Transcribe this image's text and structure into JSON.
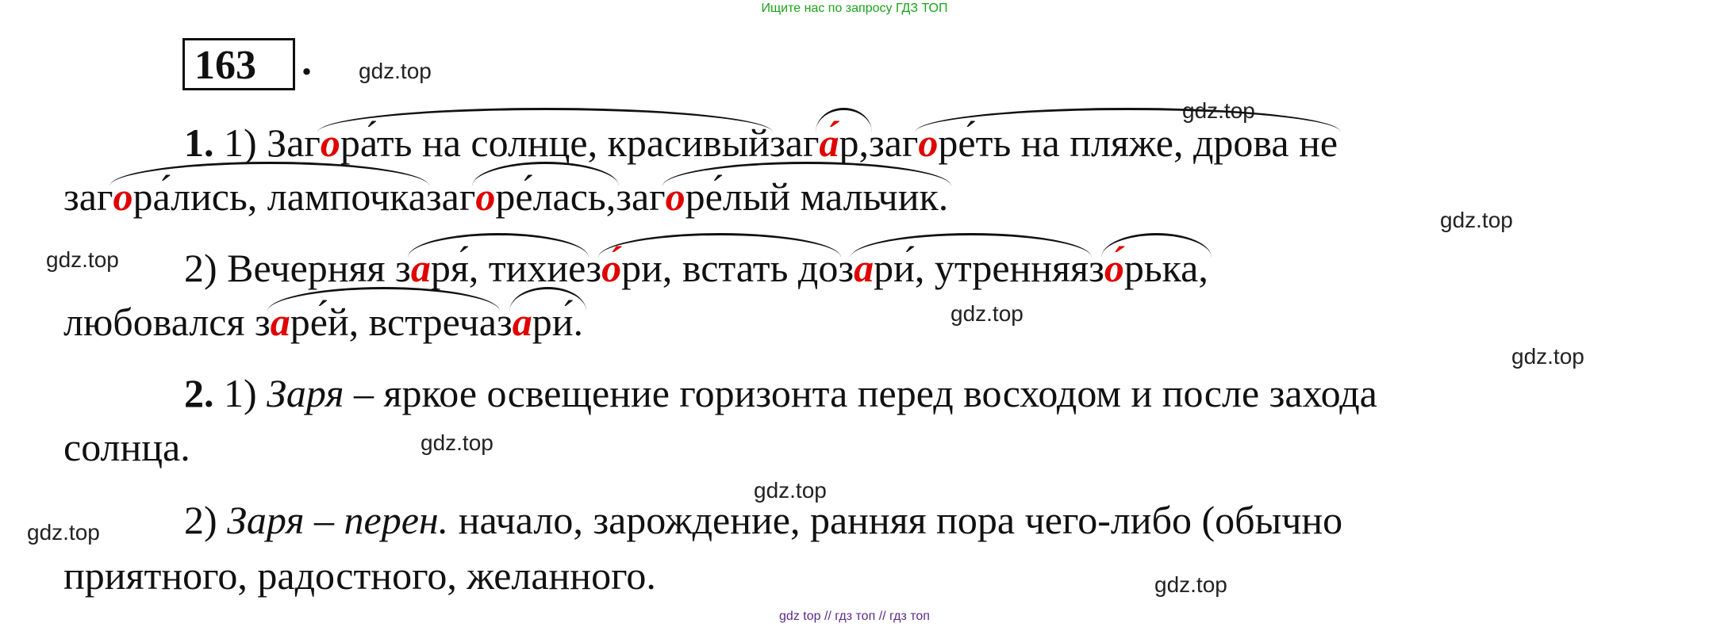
{
  "banner": "Ищите нас по запросу ГДЗ ТОП",
  "task_number": "163",
  "task_number_dot": ".",
  "watermark": "gdz.top",
  "lines": {
    "l1": {
      "num": "1.",
      "sub": " 1) ",
      "w1a": "Заг",
      "w1r": "о",
      "w1b": "ра́ть на солнце, красивый ",
      "w2a": "заг",
      "w2r": "а́",
      "w2b": "р, ",
      "w3a": "заг",
      "w3r": "о",
      "w3b": "ре́ть на пляже, дрова не"
    },
    "l2": {
      "w1a": "заг",
      "w1r": "о",
      "w1b": "ра́лись, лампочка ",
      "w2a": "заг",
      "w2r": "о",
      "w2b": "ре́лась, ",
      "w3a": "заг",
      "w3r": "о",
      "w3b": "ре́лый мальчик."
    },
    "l3": {
      "sub": "2) Вечерняя ",
      "w1a": "з",
      "w1r": "а",
      "w1b": "ря́, тихие ",
      "w2a": "з",
      "w2r": "о́",
      "w2b": "ри, встать до ",
      "w3a": "з",
      "w3r": "а",
      "w3b": "ри́, утренняя ",
      "w4a": "з",
      "w4r": "о́",
      "w4b": "рька,"
    },
    "l4": {
      "pre": "любовался ",
      "w1a": "з",
      "w1r": "а",
      "w1b": "ре́й, встреча ",
      "w2a": "з",
      "w2r": "а",
      "w2b": "ри́."
    },
    "l5": {
      "num": "2.",
      "sub": " 1) ",
      "term": "Заря",
      "rest": " – яркое освещение горизонта перед восходом и после захода"
    },
    "l6": {
      "text": "солнца."
    },
    "l7": {
      "sub": "2) ",
      "term": "Заря – перен.",
      "rest": " начало, зарождение, ранняя пора чего-либо (обычно"
    },
    "l8": {
      "text": "приятного, радостного, желанного."
    }
  },
  "footer": "gdz top  //  гдз топ  //  гдз топ"
}
